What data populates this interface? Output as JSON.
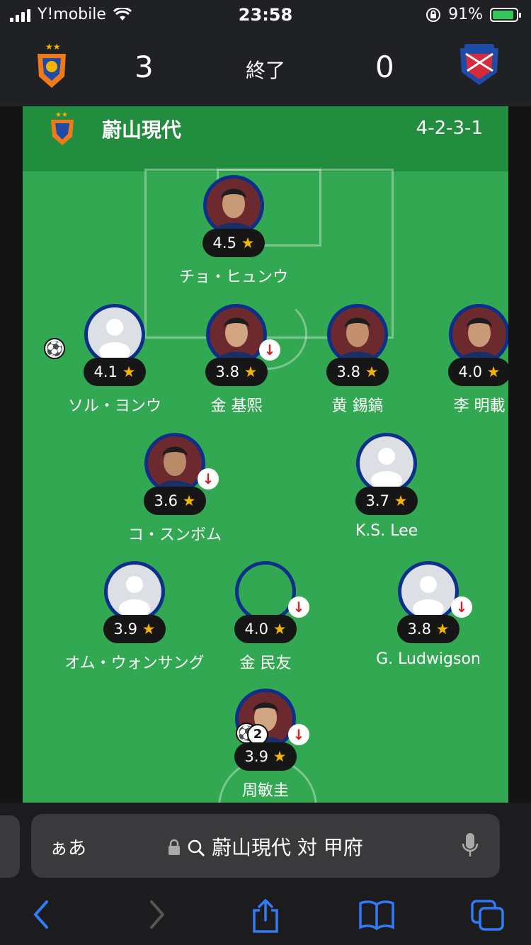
{
  "status_bar": {
    "carrier": "Y!mobile",
    "time": "23:58",
    "battery": "91%",
    "battery_level": 0.91
  },
  "match": {
    "home_score": "3",
    "away_score": "0",
    "status": "終了"
  },
  "lineup": {
    "team_name": "蔚山現代",
    "formation": "4-2-3-1",
    "star": "★",
    "sub_arrow": "↓",
    "goal_icon": "soccer-ball-icon",
    "players": [
      {
        "name": "チョ・ヒュンウ",
        "rating": "4.5",
        "photo": "face",
        "sub": false
      },
      {
        "name": "ソル・ヨンウ",
        "rating": "4.1",
        "photo": "default",
        "sub": false,
        "goal": true
      },
      {
        "name": "金 基熙",
        "rating": "3.8",
        "photo": "face",
        "sub": true
      },
      {
        "name": "黄 錫鎬",
        "rating": "3.8",
        "photo": "face",
        "sub": false
      },
      {
        "name": "李 明載",
        "rating": "4.0",
        "photo": "face",
        "sub": false
      },
      {
        "name": "コ・スンボム",
        "rating": "3.6",
        "photo": "face",
        "sub": true
      },
      {
        "name": "K.S. Lee",
        "rating": "3.7",
        "photo": "default",
        "sub": false
      },
      {
        "name": "オム・ウォンサング",
        "rating": "3.9",
        "photo": "default",
        "sub": false
      },
      {
        "name": "金 民友",
        "rating": "4.0",
        "photo": "empty",
        "sub": true
      },
      {
        "name": "G. Ludwigson",
        "rating": "3.8",
        "photo": "default",
        "sub": true
      },
      {
        "name": "周敏圭",
        "rating": "3.9",
        "photo": "face",
        "sub": true,
        "goals": "2"
      }
    ]
  },
  "browser": {
    "aa_label": "ぁあ",
    "url": "蔚山現代 対 甲府",
    "icons": [
      "back-icon",
      "forward-icon",
      "share-icon",
      "bookmarks-icon",
      "tabs-icon",
      "lock-icon",
      "search-icon",
      "mic-icon"
    ]
  },
  "colors": {
    "pitch": "#32a852",
    "header_green": "#228c3f",
    "avatar_ring": "#0b2f8a",
    "rating_star": "#f5b400",
    "sub_arrow": "#d61f26",
    "ios_blue": "#2f7cf6"
  }
}
